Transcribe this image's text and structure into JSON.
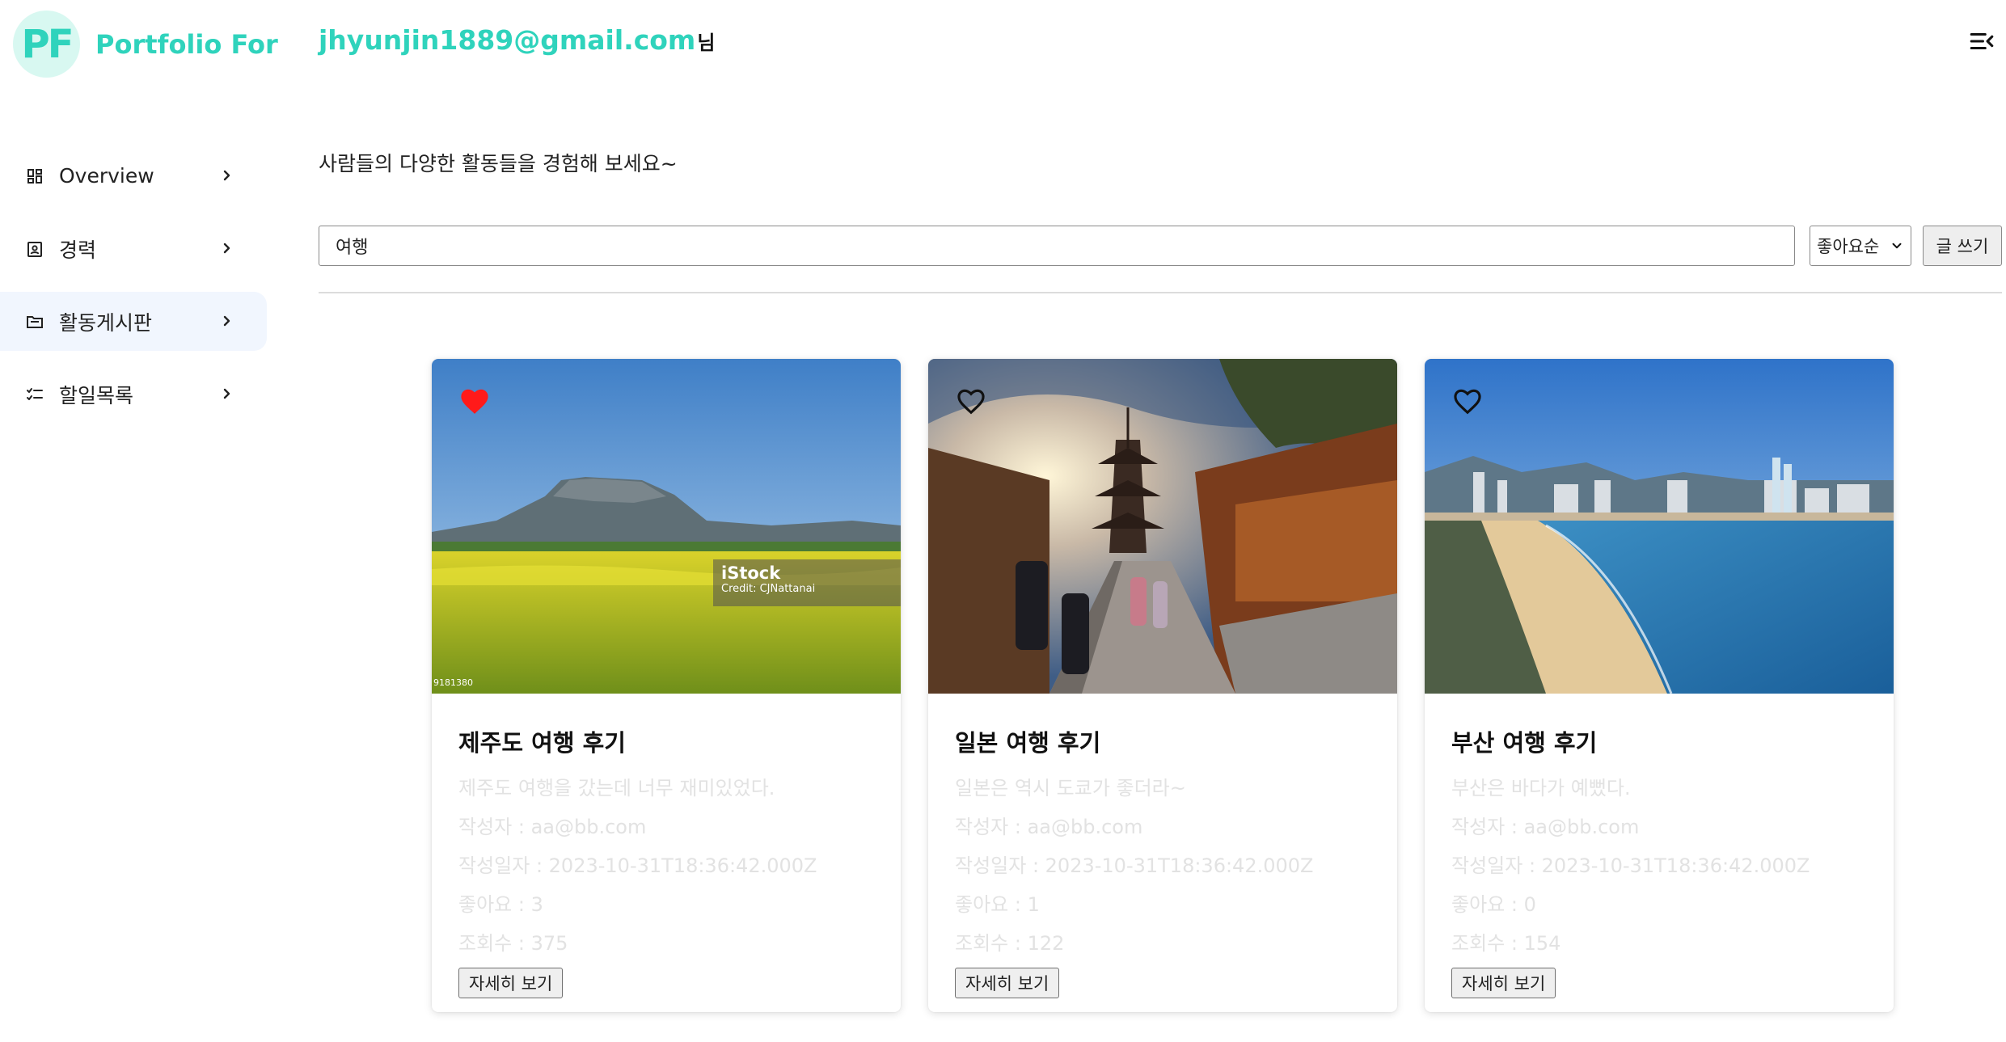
{
  "brand": {
    "logo_mark": "PF",
    "name": "Portfolio For"
  },
  "header": {
    "user_email": "jhyunjin1889@gmail.com",
    "user_suffix": "님",
    "menu_icon": "menu-collapse-icon"
  },
  "sidebar": {
    "items": [
      {
        "label": "Overview",
        "icon": "dashboard-icon",
        "active": false
      },
      {
        "label": "경력",
        "icon": "badge-icon",
        "active": false
      },
      {
        "label": "활동게시판",
        "icon": "folder-icon",
        "active": true
      },
      {
        "label": "할일목록",
        "icon": "checklist-icon",
        "active": false
      }
    ]
  },
  "main": {
    "subtitle": "사람들의 다양한 활동들을 경험해 보세요~",
    "search": {
      "value": "여행"
    },
    "sort": {
      "selected": "좋아요순"
    },
    "write_button": "글 쓰기"
  },
  "cards": [
    {
      "liked": true,
      "image": "jeju-seongsan-ilchulbong-canola-field",
      "watermark": {
        "brand": "iStock",
        "credit": "Credit: CJNattanai",
        "id": "9181380"
      },
      "title": "제주도 여행 후기",
      "description": "제주도 여행을 갔는데 너무 재미있었다.",
      "author": "작성자 : aa@bb.com",
      "date": "작성일자 : 2023-10-31T18:36:42.000Z",
      "likes": "좋아요 : 3",
      "views": "조회수 : 375",
      "button": "자세히 보기"
    },
    {
      "liked": false,
      "image": "kyoto-pagoda-street",
      "title": "일본 여행 후기",
      "description": "일본은 역시 도쿄가 좋더라~",
      "author": "작성자 : aa@bb.com",
      "date": "작성일자 : 2023-10-31T18:36:42.000Z",
      "likes": "좋아요 : 1",
      "views": "조회수 : 122",
      "button": "자세히 보기"
    },
    {
      "liked": false,
      "image": "busan-beach-city",
      "title": "부산 여행 후기",
      "description": "부산은 바다가 예뻤다.",
      "author": "작성자 : aa@bb.com",
      "date": "작성일자 : 2023-10-31T18:36:42.000Z",
      "likes": "좋아요 : 0",
      "views": "조회수 : 154",
      "button": "자세히 보기"
    }
  ],
  "colors": {
    "accent": "#2fd3bc",
    "logo_bg": "#d8f8f1",
    "active_nav_bg": "#f1f6fe",
    "heart_red": "#ff1a1a",
    "muted_text": "#e2e2e2"
  }
}
